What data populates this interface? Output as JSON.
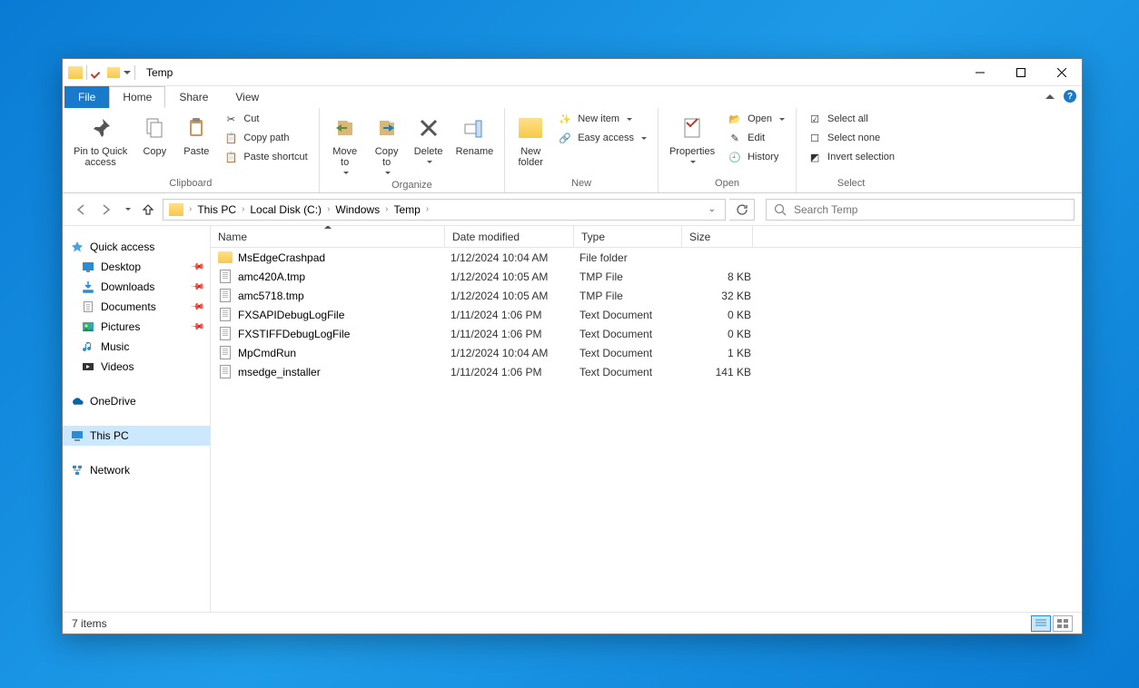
{
  "window": {
    "title": "Temp"
  },
  "tabs": {
    "file": "File",
    "home": "Home",
    "share": "Share",
    "view": "View"
  },
  "ribbon": {
    "pin_quick": "Pin to Quick\naccess",
    "copy": "Copy",
    "paste": "Paste",
    "cut": "Cut",
    "copy_path": "Copy path",
    "paste_shortcut": "Paste shortcut",
    "group_clipboard": "Clipboard",
    "move_to": "Move\nto",
    "copy_to": "Copy\nto",
    "delete": "Delete",
    "rename": "Rename",
    "group_organize": "Organize",
    "new_folder": "New\nfolder",
    "new_item": "New item",
    "easy_access": "Easy access",
    "group_new": "New",
    "properties": "Properties",
    "open": "Open",
    "edit": "Edit",
    "history": "History",
    "group_open": "Open",
    "select_all": "Select all",
    "select_none": "Select none",
    "invert_selection": "Invert selection",
    "group_select": "Select"
  },
  "breadcrumb": {
    "parts": [
      "This PC",
      "Local Disk (C:)",
      "Windows",
      "Temp"
    ]
  },
  "search": {
    "placeholder": "Search Temp"
  },
  "sidebar": {
    "quick_access": "Quick access",
    "desktop": "Desktop",
    "downloads": "Downloads",
    "documents": "Documents",
    "pictures": "Pictures",
    "music": "Music",
    "videos": "Videos",
    "onedrive": "OneDrive",
    "this_pc": "This PC",
    "network": "Network"
  },
  "columns": {
    "name": "Name",
    "date": "Date modified",
    "type": "Type",
    "size": "Size"
  },
  "files": [
    {
      "name": "MsEdgeCrashpad",
      "date": "1/12/2024 10:04 AM",
      "type": "File folder",
      "size": "",
      "icon": "folder"
    },
    {
      "name": "amc420A.tmp",
      "date": "1/12/2024 10:05 AM",
      "type": "TMP File",
      "size": "8 KB",
      "icon": "file"
    },
    {
      "name": "amc5718.tmp",
      "date": "1/12/2024 10:05 AM",
      "type": "TMP File",
      "size": "32 KB",
      "icon": "file"
    },
    {
      "name": "FXSAPIDebugLogFile",
      "date": "1/11/2024 1:06 PM",
      "type": "Text Document",
      "size": "0 KB",
      "icon": "file"
    },
    {
      "name": "FXSTIFFDebugLogFile",
      "date": "1/11/2024 1:06 PM",
      "type": "Text Document",
      "size": "0 KB",
      "icon": "file"
    },
    {
      "name": "MpCmdRun",
      "date": "1/12/2024 10:04 AM",
      "type": "Text Document",
      "size": "1 KB",
      "icon": "file"
    },
    {
      "name": "msedge_installer",
      "date": "1/11/2024 1:06 PM",
      "type": "Text Document",
      "size": "141 KB",
      "icon": "file"
    }
  ],
  "status": {
    "items": "7 items"
  }
}
